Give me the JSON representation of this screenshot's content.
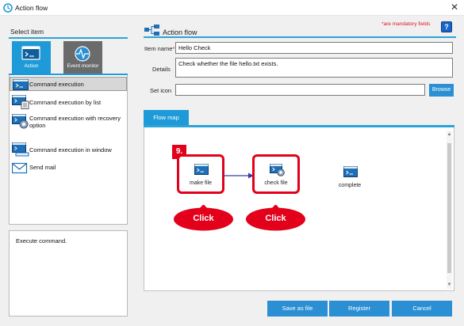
{
  "window": {
    "title": "Action flow",
    "close_glyph": "✕"
  },
  "left": {
    "select_item_label": "Select item",
    "tabs": [
      {
        "label": "Action",
        "icon": "terminal-icon",
        "active": true
      },
      {
        "label": "Event monitor",
        "icon": "pulse-monitor-icon",
        "active": false
      }
    ],
    "items": [
      {
        "label": "Command execution",
        "icon": "terminal-icon",
        "selected": true
      },
      {
        "label": "Command execution by list",
        "icon": "terminal-list-icon",
        "selected": false
      },
      {
        "label_line1": "Command execution with recovery",
        "label_line2": "option",
        "icon": "terminal-recovery-icon",
        "selected": false
      },
      {
        "label": "Command execution in window",
        "icon": "terminal-window-icon",
        "selected": false
      },
      {
        "label": "Send mail",
        "icon": "mail-icon",
        "selected": false
      }
    ],
    "description": "Execute command."
  },
  "header": {
    "title": "Action flow",
    "mandatory_note": "*are mandatory fields",
    "help_label": "?"
  },
  "form": {
    "item_name_label": "Item name",
    "required_mark": "*",
    "item_name_value": "Hello Check",
    "details_label": "Details",
    "details_value": "Check whether the file hello.txt exists.",
    "set_icon_label": "Set icon",
    "set_icon_value": "",
    "browse_label": "Browse"
  },
  "flow": {
    "tab_label": "Flow map",
    "step_badge": "9.",
    "nodes": [
      {
        "label": "make file",
        "icon": "terminal-icon",
        "highlighted": true
      },
      {
        "label": "check file",
        "icon": "terminal-recovery-icon",
        "highlighted": true
      },
      {
        "label": "complete",
        "icon": "terminal-icon",
        "highlighted": false
      }
    ],
    "callouts": [
      "Click",
      "Click"
    ]
  },
  "buttons": {
    "save_as_file": "Save as file",
    "register": "Register",
    "cancel": "Cancel"
  },
  "colors": {
    "accent": "#1f9ad8",
    "button": "#2b8fd3",
    "highlight_red": "#e3001b",
    "mandatory_red": "#e0141e",
    "inactive_tab": "#6b6b6b"
  }
}
